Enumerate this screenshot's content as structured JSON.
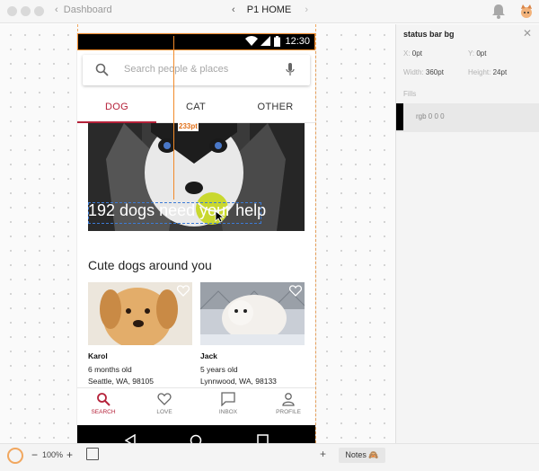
{
  "toolbar": {
    "back_label": "Dashboard",
    "page_name": "P1 HOME",
    "prev_arrow": "‹",
    "next_arrow": "›"
  },
  "phone": {
    "status_time": "12:30",
    "search_placeholder": "Search people & places",
    "tabs": [
      {
        "label": "DOG",
        "active": true
      },
      {
        "label": "CAT",
        "active": false
      },
      {
        "label": "OTHER",
        "active": false
      }
    ],
    "hero_text": "192 dogs need your help",
    "section_title": "Cute dogs around you",
    "cards": [
      {
        "name": "Karol",
        "age": "6 months old",
        "location": "Seattle, WA, 98105"
      },
      {
        "name": "Jack",
        "age": "5 years old",
        "location": "Lynnwood, WA, 98133"
      }
    ],
    "bottom_nav": [
      {
        "label": "SEARCH",
        "icon": "search-icon",
        "active": true
      },
      {
        "label": "LOVE",
        "icon": "heart-icon",
        "active": false
      },
      {
        "label": "INBOX",
        "icon": "chat-icon",
        "active": false
      },
      {
        "label": "PROFILE",
        "icon": "person-icon",
        "active": false
      }
    ]
  },
  "overlay": {
    "measure_label": "233pt"
  },
  "inspector": {
    "title": "status bar bg",
    "x_label": "X:",
    "x_value": "0pt",
    "y_label": "Y:",
    "y_value": "0pt",
    "width_label": "Width:",
    "width_value": "360pt",
    "height_label": "Height:",
    "height_value": "24pt",
    "fills_label": "Fills",
    "fill_value": "rgb 0 0 0",
    "fill_color": "#000000"
  },
  "footer": {
    "zoom": "100%",
    "zoom_minus": "−",
    "zoom_plus": "+",
    "add": "+",
    "notes": "Notes 🙈"
  },
  "colors": {
    "accent": "#b5223a",
    "measure": "#f18a2a",
    "selection": "#3c7bd6"
  }
}
